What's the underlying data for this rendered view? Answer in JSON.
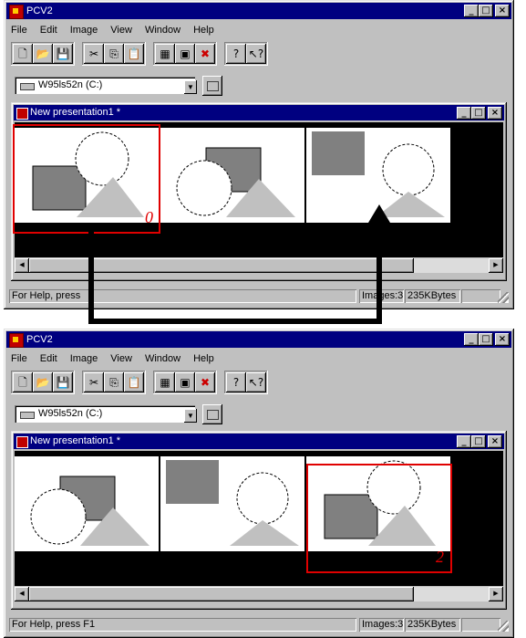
{
  "window": {
    "title": "PCV2",
    "min": "_",
    "max": "□",
    "close": "×"
  },
  "menu": [
    "File",
    "Edit",
    "Image",
    "View",
    "Window",
    "Help"
  ],
  "toolbar": {
    "icons": [
      "new-icon",
      "open-icon",
      "save-icon",
      "cut-icon",
      "copy-icon",
      "paste-icon",
      "slideshow-icon",
      "thumbnail-icon",
      "delete-image-icon",
      "help-icon",
      "context-help-icon"
    ],
    "glyphs": [
      "🗋",
      "📂",
      "💾",
      "✂",
      "⎘",
      "📋",
      "▦",
      "▣",
      "✖",
      "?",
      "↖?"
    ]
  },
  "drive": {
    "label": "W95ls52n (C:)",
    "dropdown": "▼"
  },
  "child": {
    "title": "New presentation1 *"
  },
  "status": {
    "help_top": "For Help, press",
    "help_bottom": "For Help, press F1",
    "images": "Images:3",
    "size": "235KBytes"
  },
  "scroll": {
    "left": "◀",
    "right": "▶"
  },
  "labels": {
    "top": "0",
    "bottom": "2"
  },
  "colors": {
    "titlebar": "#000080",
    "highlight": "#e00000",
    "shape_dark": "#808080",
    "shape_light": "#c0c0c0"
  }
}
